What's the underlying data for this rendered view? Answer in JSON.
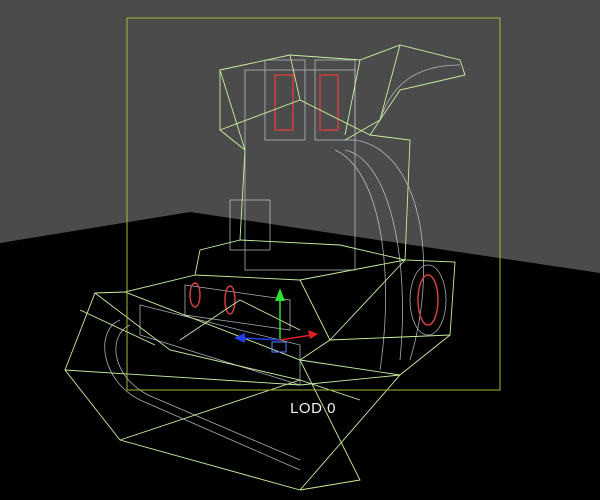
{
  "viewport": {
    "lod_label": "LOD 0",
    "colors": {
      "background": "#4b4b4b",
      "floor": "#000000",
      "bounds_box": "#a9b83a",
      "hull_wire": "#c8f0a0",
      "mesh_wire": "#c9ccd8",
      "accent_red": "#d04040",
      "gizmo_x": "#e02020",
      "gizmo_y": "#30e030",
      "gizmo_z": "#2040f0"
    }
  }
}
